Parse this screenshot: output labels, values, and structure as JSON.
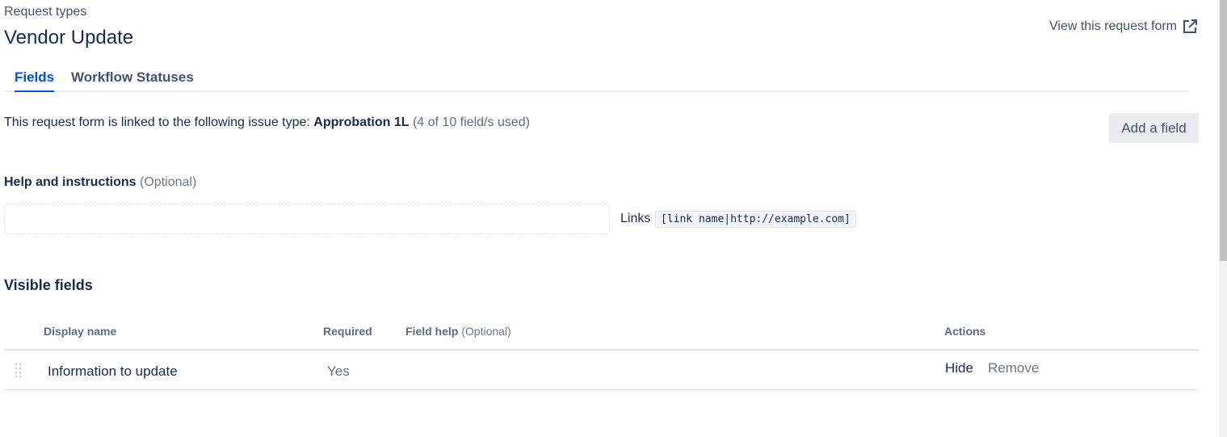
{
  "header": {
    "breadcrumb": "Request types",
    "title": "Vendor Update",
    "view_form_link": "View this request form",
    "view_form_icon": "external-link-icon"
  },
  "tabs": [
    {
      "label": "Fields",
      "active": true
    },
    {
      "label": "Workflow Statuses",
      "active": false
    }
  ],
  "linked": {
    "prefix": "This request form is linked to the following issue type: ",
    "issue_type": "Approbation 1L",
    "usage": " (4 of 10 field/s used)"
  },
  "add_field_button": "Add a field",
  "help": {
    "heading": "Help and instructions",
    "optional": " (Optional)",
    "value": "",
    "links_label": "Links",
    "links_syntax": "[link name|http://example.com]"
  },
  "visible_fields": {
    "heading": "Visible fields",
    "columns": {
      "display_name": "Display name",
      "required": "Required",
      "field_help": "Field help",
      "field_help_optional": " (Optional)",
      "actions": "Actions"
    },
    "rows": [
      {
        "display_name": "Information to update",
        "required": "Yes",
        "field_help": "",
        "hide_label": "Hide",
        "remove_label": "Remove"
      }
    ]
  },
  "colors": {
    "accent": "#0052cc",
    "text": "#172b4d",
    "subtle_text": "#5e6c84",
    "button_bg": "#ebecf0"
  }
}
